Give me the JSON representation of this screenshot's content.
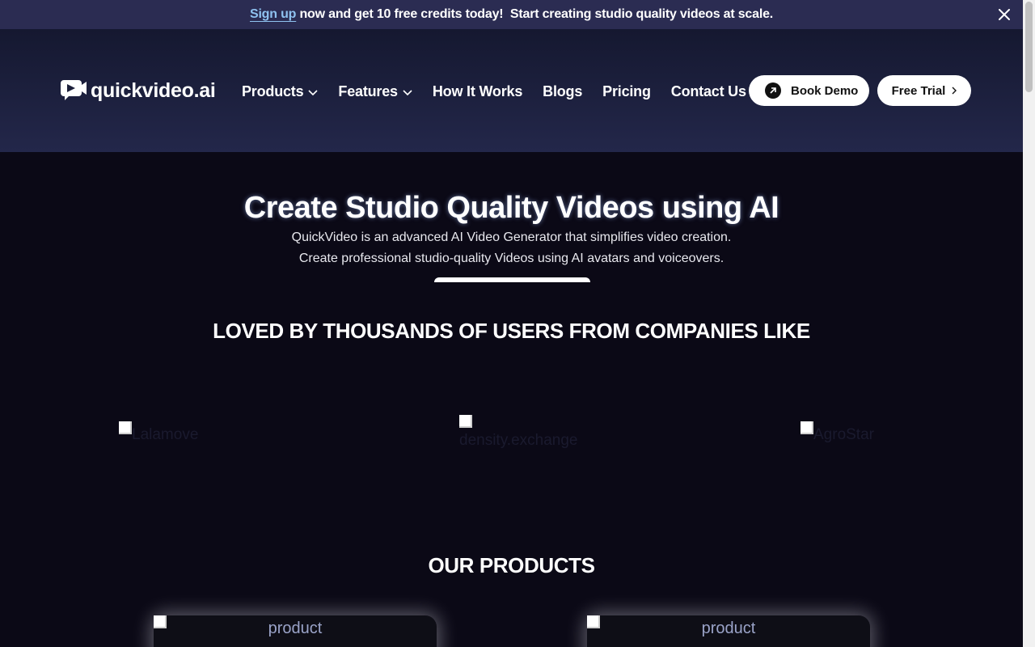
{
  "announcement": {
    "signup_link": "Sign up",
    "text": " now and get 10 free credits today!  Start creating studio quality videos at scale."
  },
  "header": {
    "logo_text": "quickvideo.ai",
    "nav": {
      "products": "Products",
      "features": "Features",
      "how_it_works": "How It Works",
      "blogs": "Blogs",
      "pricing": "Pricing",
      "contact": "Contact Us"
    },
    "book_demo": "Book Demo",
    "free_trial": "Free Trial"
  },
  "hero": {
    "title": "Create Studio Quality Videos using AI",
    "subtitle_line1": "QuickVideo is an advanced AI Video Generator that simplifies video creation.",
    "subtitle_line2": "Create professional studio-quality Videos using AI avatars and voiceovers."
  },
  "companies": {
    "heading": "LOVED BY THOUSANDS OF USERS FROM COMPANIES LIKE",
    "logos": [
      "Lalamove",
      "density.exchange",
      "AgroStar"
    ]
  },
  "products": {
    "heading": "OUR PRODUCTS",
    "cards": [
      "product",
      "product"
    ]
  },
  "colors": {
    "announcement_bg": "#2b2c52",
    "page_bg": "#0b0916",
    "signup_link": "#8fc2f0"
  }
}
